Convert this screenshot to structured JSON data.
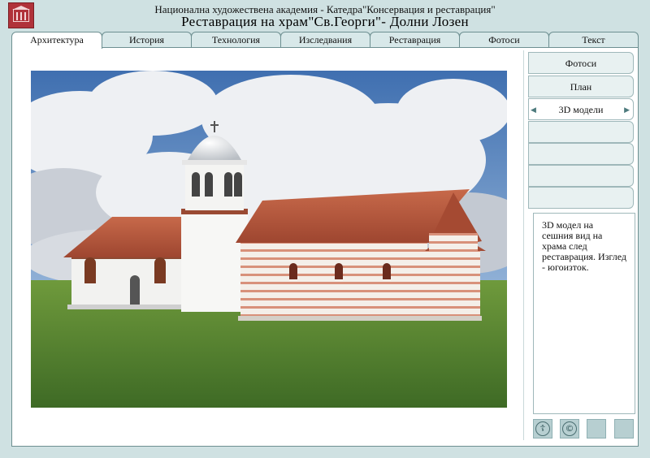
{
  "header": {
    "subtitle": "Национална художествена академия - Катедра\"Консервация и реставрация\"",
    "title": "Реставрация на храм\"Св.Георги\"- Долни Лозен"
  },
  "tabs": [
    {
      "label": "Архитектура",
      "active": true
    },
    {
      "label": "История"
    },
    {
      "label": "Технология"
    },
    {
      "label": "Изследвания"
    },
    {
      "label": "Реставрация"
    },
    {
      "label": "Фотоси"
    },
    {
      "label": "Текст"
    }
  ],
  "side_menu": [
    {
      "label": "Фотоси"
    },
    {
      "label": "План"
    },
    {
      "label": "3D модели",
      "selected": true
    },
    {
      "label": ""
    },
    {
      "label": ""
    },
    {
      "label": ""
    },
    {
      "label": ""
    }
  ],
  "description": "3D модел на сешния вид на храма след реставрация. Изглед - югоизток.",
  "bottom_icons": [
    "orthodox-cross-circle-icon",
    "copyright-icon",
    "blank-square-icon",
    "blank-square-icon"
  ],
  "colors": {
    "background": "#cfe1e2",
    "frame_border": "#6d8f91",
    "logo": "#b0323a",
    "roof": "#b6553a"
  }
}
